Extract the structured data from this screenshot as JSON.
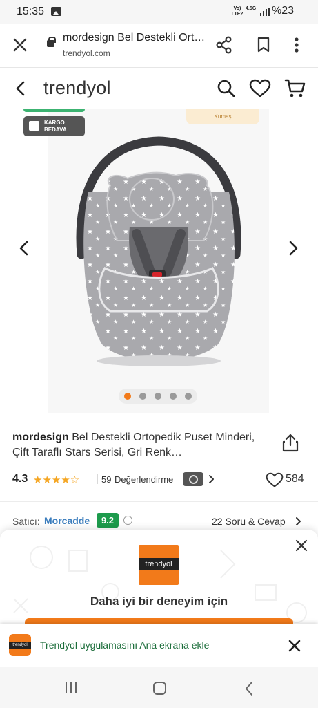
{
  "status_bar": {
    "time": "15:35",
    "network_top": "Vo)",
    "network_bottom": "LTE2",
    "network_type": "4.5G",
    "battery": "%23"
  },
  "browser": {
    "title": "mordesign Bel Destekli Ort…",
    "url": "trendyol.com"
  },
  "site_header": {
    "logo": "trendyol"
  },
  "gallery": {
    "image_tag": "Kumaş",
    "badge_line1": "KARGO",
    "badge_line2": "BEDAVA",
    "page_count": 5,
    "active_index": 0,
    "active_dot_color": "#f27a1a"
  },
  "product": {
    "brand": "mordesign",
    "name": "Bel Destekli Ortopedik Puset Minderi, Çift Taraflı Stars Serisi, Gri Renk…",
    "rating": "4.3",
    "rating_value": 4.3,
    "stars": "★★★★☆",
    "review_count": "59",
    "review_label": "Değerlendirme",
    "favorite_count": "584"
  },
  "seller": {
    "label": "Satıcı:",
    "name": "Morcadde",
    "score": "9.2",
    "qa_label": "22 Soru & Cevap"
  },
  "app_promo": {
    "logo_text": "trendyol",
    "headline": "Daha iyi bir deneyim için"
  },
  "add_to_home": {
    "icon_text": "trendyol",
    "text": "Trendyol uygulamasını Ana ekrana ekle"
  },
  "colors": {
    "brand_orange": "#f27a1a",
    "seller_blue": "#3b7dbd",
    "score_green": "#1d9b4c",
    "star_gold": "#f5a623"
  }
}
